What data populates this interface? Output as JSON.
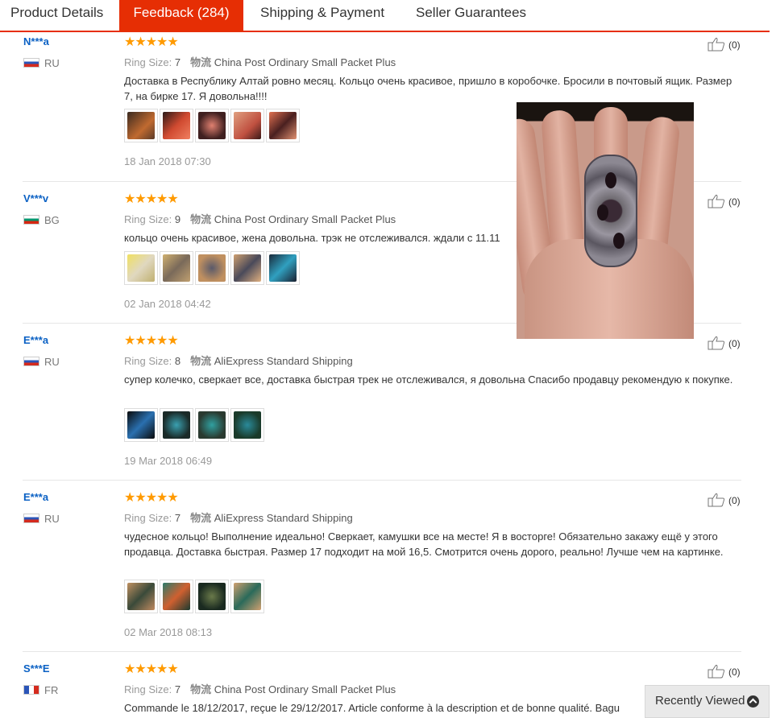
{
  "tabs": [
    {
      "label": "Product Details"
    },
    {
      "label": "Feedback (284)"
    },
    {
      "label": "Shipping & Payment"
    },
    {
      "label": "Seller Guarantees"
    }
  ],
  "meta_labels": {
    "ring_size": "Ring Size:",
    "shipping": "物流"
  },
  "reviews": [
    {
      "user": "N***a",
      "country": "RU",
      "ring_size": "7",
      "shipping": "China Post Ordinary Small Packet Plus",
      "text": "Доставка в Республику Алтай ровно месяц. Кольцо очень красивое, пришло в коробочке. Бросили в почтовый ящик. Размер 7, на бирке 17. Я довольна!!!!",
      "date": "18 Jan 2018 07:30",
      "helpful": "(0)"
    },
    {
      "user": "V***v",
      "country": "BG",
      "ring_size": "9",
      "shipping": "China Post Ordinary Small Packet Plus",
      "text": "кольцо очень красивое, жена довольна. трэк не отслеживался. ждали с 11.11",
      "date": "02 Jan 2018 04:42",
      "helpful": "(0)"
    },
    {
      "user": "E***a",
      "country": "RU",
      "ring_size": "8",
      "shipping": "AliExpress Standard Shipping",
      "text": "супер колечко, сверкает все, доставка быстрая трек не отслеживался, я довольна Спасибо продавцу рекомендую к покупке.",
      "date": "19 Mar 2018 06:49",
      "helpful": "(0)"
    },
    {
      "user": "E***a",
      "country": "RU",
      "ring_size": "7",
      "shipping": "AliExpress Standard Shipping",
      "text": "чудесное кольцо! Выполнение идеально! Сверкает, камушки все на месте! Я в восторге! Обязательно закажу ещё у этого продавца. Доставка быстрая. Размер 17 подходит на мой 16,5. Смотрится очень дорого, реально! Лучше чем на картинке.",
      "date": "02 Mar 2018 08:13",
      "helpful": "(0)"
    },
    {
      "user": "S***E",
      "country": "FR",
      "ring_size": "7",
      "shipping": "China Post Ordinary Small Packet Plus",
      "text": "Commande le 18/12/2017, reçue le 29/12/2017. Article conforme à la description et de bonne qualité. Bagu",
      "helpful": "(0)"
    }
  ],
  "stars_glyphs": "★★★★★",
  "recently_viewed": "Recently Viewed"
}
